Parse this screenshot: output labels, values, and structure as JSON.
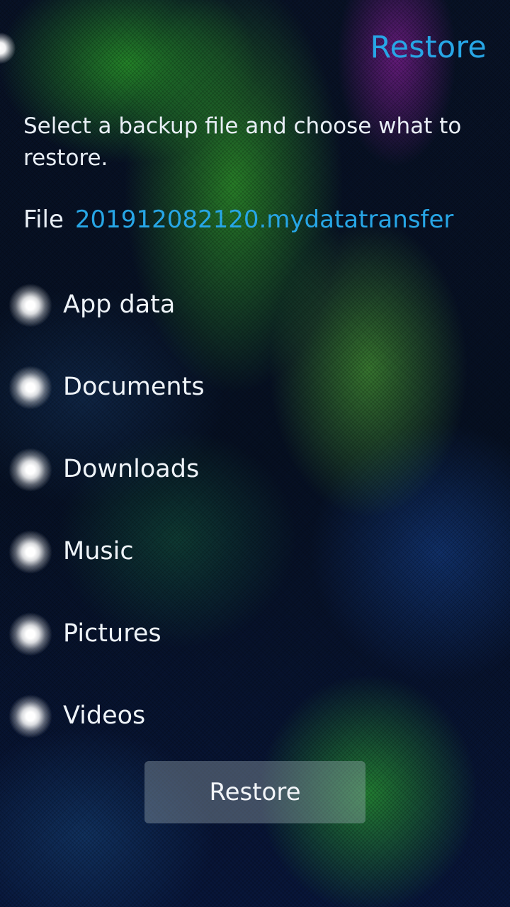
{
  "header": {
    "title": "Restore"
  },
  "description": "Select a backup file and choose what to restore.",
  "file": {
    "label": "File",
    "name": "201912082120.mydatatransfer"
  },
  "options": [
    {
      "label": "App data"
    },
    {
      "label": "Documents"
    },
    {
      "label": "Downloads"
    },
    {
      "label": "Music"
    },
    {
      "label": "Pictures"
    },
    {
      "label": "Videos"
    }
  ],
  "actions": {
    "restore_label": "Restore"
  },
  "colors": {
    "accent": "#27a6e6",
    "text": "#e8eef5"
  }
}
